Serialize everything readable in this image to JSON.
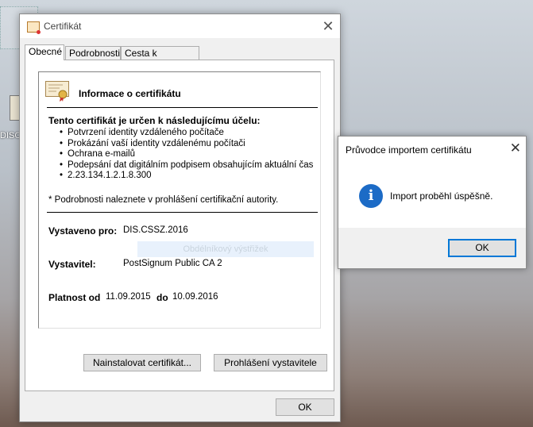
{
  "desktop": {
    "icon_label": "DISC"
  },
  "cert_window": {
    "title": "Certifikát",
    "tabs": [
      "Obecné",
      "Podrobnosti",
      "Cesta k certifikátu"
    ],
    "info_title": "Informace o certifikátu",
    "purpose_heading": "Tento certifikát je určen k následujícímu účelu:",
    "purposes": [
      "Potvrzení identity vzdáleného počítače",
      "Prokázání vaší identity vzdálenému počítači",
      "Ochrana e-mailů",
      "Podepsání dat digitálním podpisem obsahujícím aktuální čas",
      "2.23.134.1.2.1.8.300"
    ],
    "note": "* Podrobnosti naleznete v prohlášení certifikační autority.",
    "issued_to_label": "Vystaveno pro:",
    "issued_to_value": "DIS.CSSZ.2016",
    "issuer_label": "Vystavitel:",
    "issuer_value": "PostSignum Public CA 2",
    "valid_from_label": "Platnost od",
    "valid_from_value": "11.09.2015",
    "valid_to_label": "do",
    "valid_to_value": "10.09.2016",
    "ghost_text": "Obdélníkový výstřižek",
    "install_button": "Nainstalovat certifikát...",
    "statement_button": "Prohlášení vystavitele",
    "ok_button": "OK"
  },
  "import_dialog": {
    "title": "Průvodce importem certifikátu",
    "message": "Import proběhl úspěšně.",
    "ok_button": "OK"
  },
  "colors": {
    "accent": "#0078d7",
    "info_icon": "#1c6bc6"
  }
}
